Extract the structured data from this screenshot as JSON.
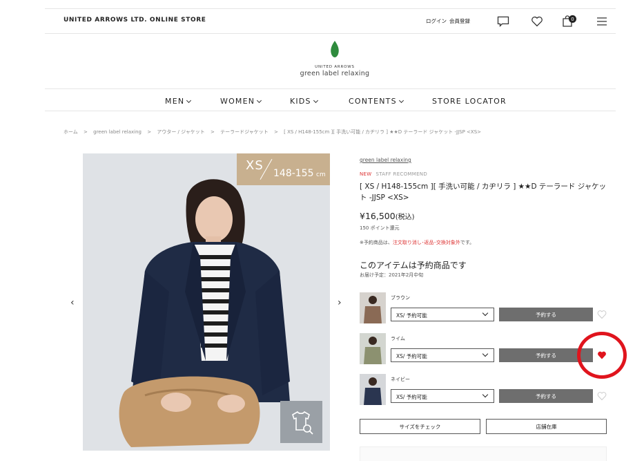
{
  "header": {
    "store_title": "UNITED ARROWS LTD. ONLINE STORE",
    "login": "ログイン",
    "register": "会員登録",
    "cart_count": "0",
    "icons": [
      "chat-icon",
      "heart-icon",
      "cart-icon",
      "menu-icon"
    ]
  },
  "brand": {
    "small": "UNITED ARROWS",
    "name": "green label relaxing",
    "logo_color": "#2e8b3d"
  },
  "nav": {
    "items": [
      {
        "label": "MEN"
      },
      {
        "label": "WOMEN"
      },
      {
        "label": "KIDS"
      },
      {
        "label": "CONTENTS"
      },
      {
        "label": "STORE LOCATOR"
      }
    ]
  },
  "breadcrumb": {
    "items": [
      "ホーム",
      ">",
      "green label relaxing",
      ">",
      "アウター / ジャケット",
      ">",
      "テーラードジャケット",
      ">",
      "[ XS / H148-155cm ][ 手洗い可能 / カヂリラ ] ★★D テーラード ジャケット -JJSP <XS>"
    ]
  },
  "gallery": {
    "size_main": "XS",
    "size_range": "148-155",
    "size_unit": "cm",
    "prev": "‹",
    "next": "›"
  },
  "product": {
    "brand_link": "green label relaxing",
    "label_new": "NEW",
    "label_staff": "STAFF RECOMMEND",
    "title": "[ XS / H148-155cm ][ 手洗い可能 / カヂリラ ] ★★D テーラード ジャケット -JJSP <XS>",
    "price": "¥16,500",
    "tax": "(税込)",
    "points": "150 ポイント還元",
    "notice_prefix": "※予約商品は、",
    "notice_red": "注文取り消し･返品･交換対象外",
    "notice_suffix": "です。",
    "preorder_title": "このアイテムは予約商品です",
    "delivery": "お届け予定：2021年2月中旬"
  },
  "variants": [
    {
      "name": "ブラウン",
      "select": "XS/ 予約可能",
      "button": "予約する",
      "favorited": false
    },
    {
      "name": "ライム",
      "select": "XS/ 予約可能",
      "button": "予約する",
      "favorited": true
    },
    {
      "name": "ネイビー",
      "select": "XS/ 予約可能",
      "button": "予約する",
      "favorited": false
    }
  ],
  "actions": {
    "size_check": "サイズをチェック",
    "store_stock": "店舗在庫"
  },
  "colors": {
    "accent_red": "#e0141d",
    "new_label": "#d33333",
    "reserve_button": "#6e6e6e"
  }
}
